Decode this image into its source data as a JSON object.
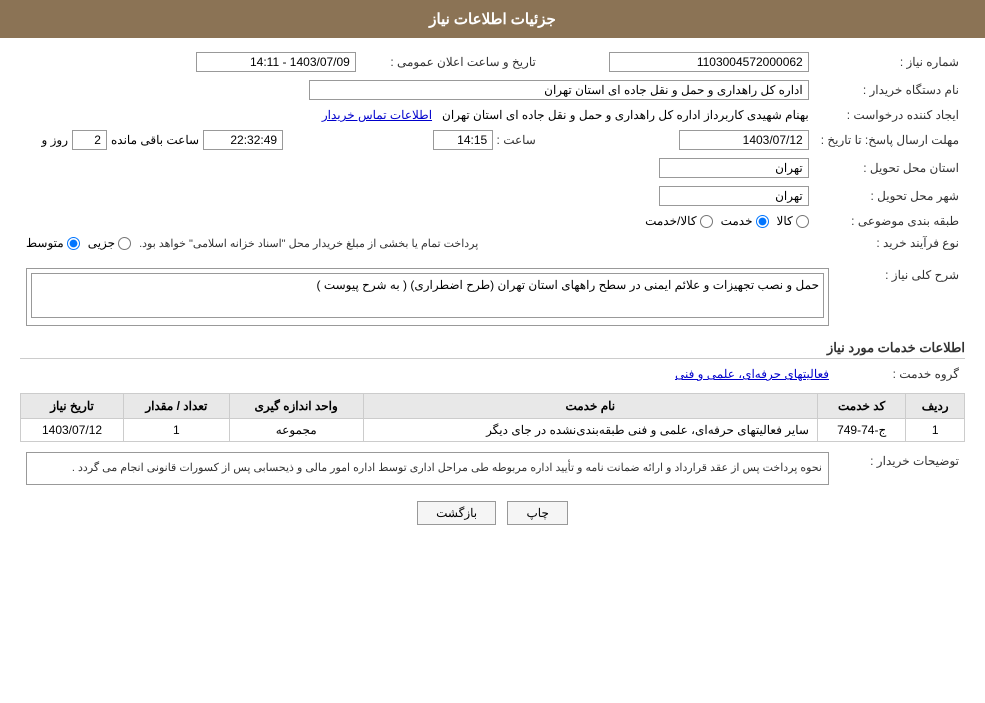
{
  "header": {
    "title": "جزئیات اطلاعات نیاز"
  },
  "form": {
    "shomara_niaz_label": "شماره نیاز :",
    "shomara_niaz_value": "1103004572000062",
    "tarikh_label": "تاریخ و ساعت اعلان عمومی :",
    "tarikh_value": "1403/07/09 - 14:11",
    "nam_dastgah_label": "نام دستگاه خریدار :",
    "nam_dastgah_value": "اداره کل راهداری و حمل و نقل جاده ای استان تهران",
    "ijad_label": "ایجاد کننده درخواست :",
    "ijad_value": "بهنام شهیدی کاربرداز اداره کل راهداری و حمل و نقل جاده ای استان تهران",
    "ijad_link": "اطلاعات تماس خریدار",
    "mohlat_label": "مهلت ارسال پاسخ: تا تاریخ :",
    "mohlat_date": "1403/07/12",
    "mohlat_saat_label": "ساعت :",
    "mohlat_saat": "14:15",
    "mohlat_roz_label": "روز و",
    "mohlat_roz": "2",
    "mohlat_mande_label": "ساعت باقی مانده",
    "mohlat_mande": "22:32:49",
    "ostan_label": "استان محل تحویل :",
    "ostan_value": "تهران",
    "shahr_label": "شهر محل تحویل :",
    "shahr_value": "تهران",
    "tabaqe_label": "طبقه بندی موضوعی :",
    "tabaqe_options": [
      {
        "label": "کالا",
        "value": "kala"
      },
      {
        "label": "خدمت",
        "value": "khedmat",
        "checked": true
      },
      {
        "label": "کالا/خدمت",
        "value": "kala_khedmat"
      }
    ],
    "noeFarayand_label": "نوع فرآیند خرید :",
    "noeFarayand_options": [
      {
        "label": "جزیی",
        "value": "jozii"
      },
      {
        "label": "متوسط",
        "value": "motevaset",
        "checked": true
      }
    ],
    "noeFarayand_note": "پرداخت تمام یا بخشی از مبلغ خریدار محل \"اسناد خزانه اسلامی\" خواهد بود.",
    "sharh_label": "شرح کلی نیاز :",
    "sharh_value": "حمل و نصب تجهیزات و علائم ایمنی در سطح راههای استان تهران (طرح اضطراری) ( به شرح پیوست )",
    "khadamat_title": "اطلاعات خدمات مورد نیاز",
    "gorohe_label": "گروه خدمت :",
    "gorohe_value": "فعالیتهای حرفه‌ای، علمی و فنی",
    "table": {
      "headers": [
        "ردیف",
        "کد خدمت",
        "نام خدمت",
        "واحد اندازه گیری",
        "تعداد / مقدار",
        "تاریخ نیاز"
      ],
      "rows": [
        {
          "radif": "1",
          "kod": "ج-74-749",
          "name": "سایر فعالیتهای حرفه‌ای، علمی و فنی طبقه‌بندی‌نشده در جای دیگر",
          "vahed": "مجموعه",
          "tedad": "1",
          "tarikh": "1403/07/12"
        }
      ]
    },
    "tozihat_label": "توضیحات خریدار :",
    "tozihat_value": "نحوه پرداخت پس از عقد قرارداد و ارائه ضمانت نامه و تأیید اداره مربوطه طی مراحل اداری توسط اداره امور مالی و ذیحسابی پس از کسورات قانونی انجام می گردد .",
    "buttons": {
      "chap": "چاپ",
      "bazgasht": "بازگشت"
    }
  }
}
